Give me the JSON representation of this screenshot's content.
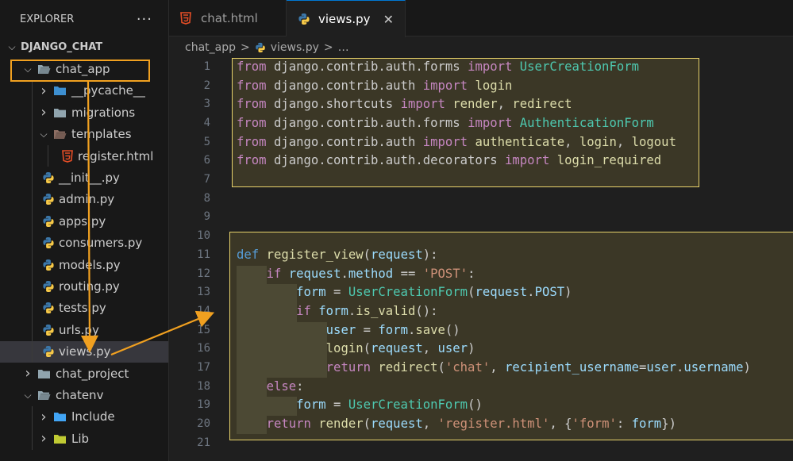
{
  "sidebar": {
    "header": "EXPLORER",
    "more": "···",
    "tree": [
      {
        "label": "DJANGO_CHAT",
        "type": "root",
        "expanded": true
      },
      {
        "label": "chat_app",
        "type": "folder",
        "expanded": true,
        "highlighted": true
      },
      {
        "label": "__pycache__",
        "type": "folder-special",
        "expanded": false
      },
      {
        "label": "migrations",
        "type": "folder",
        "expanded": false
      },
      {
        "label": "templates",
        "type": "folder",
        "expanded": true
      },
      {
        "label": "register.html",
        "type": "html"
      },
      {
        "label": "__init__.py",
        "type": "python"
      },
      {
        "label": "admin.py",
        "type": "python"
      },
      {
        "label": "apps.py",
        "type": "python"
      },
      {
        "label": "consumers.py",
        "type": "python"
      },
      {
        "label": "models.py",
        "type": "python"
      },
      {
        "label": "routing.py",
        "type": "python"
      },
      {
        "label": "tests.py",
        "type": "python"
      },
      {
        "label": "urls.py",
        "type": "python"
      },
      {
        "label": "views.py",
        "type": "python",
        "selected": true
      },
      {
        "label": "chat_project",
        "type": "folder",
        "expanded": false
      },
      {
        "label": "chatenv",
        "type": "folder",
        "expanded": true
      },
      {
        "label": "Include",
        "type": "folder-include",
        "expanded": false
      },
      {
        "label": "Lib",
        "type": "folder-lib",
        "expanded": false
      }
    ]
  },
  "tabs": [
    {
      "label": "chat.html",
      "icon": "html5-icon",
      "active": false
    },
    {
      "label": "views.py",
      "icon": "python-icon",
      "active": true,
      "close": "✕"
    }
  ],
  "breadcrumb": {
    "folder": "chat_app",
    "sep": ">",
    "file": "views.py",
    "tail": "…"
  },
  "code": {
    "line_numbers": [
      "1",
      "2",
      "3",
      "4",
      "5",
      "6",
      "7",
      "8",
      "9",
      "10",
      "11",
      "12",
      "13",
      "14",
      "15",
      "16",
      "17",
      "18",
      "19",
      "20",
      "21"
    ],
    "lines": [
      [
        [
          "kw",
          "from "
        ],
        [
          "pl",
          "django.contrib.auth.forms "
        ],
        [
          "kw",
          "import "
        ],
        [
          "cls",
          "UserCreationForm"
        ]
      ],
      [
        [
          "kw",
          "from "
        ],
        [
          "pl",
          "django.contrib.auth "
        ],
        [
          "kw",
          "import "
        ],
        [
          "fn",
          "login"
        ]
      ],
      [
        [
          "kw",
          "from "
        ],
        [
          "pl",
          "django.shortcuts "
        ],
        [
          "kw",
          "import "
        ],
        [
          "fn",
          "render"
        ],
        [
          "pl",
          ", "
        ],
        [
          "fn",
          "redirect"
        ]
      ],
      [
        [
          "kw",
          "from "
        ],
        [
          "pl",
          "django.contrib.auth.forms "
        ],
        [
          "kw",
          "import "
        ],
        [
          "cls",
          "AuthenticationForm"
        ]
      ],
      [
        [
          "kw",
          "from "
        ],
        [
          "pl",
          "django.contrib.auth "
        ],
        [
          "kw",
          "import "
        ],
        [
          "fn",
          "authenticate"
        ],
        [
          "pl",
          ", "
        ],
        [
          "fn",
          "login"
        ],
        [
          "pl",
          ", "
        ],
        [
          "fn",
          "logout"
        ]
      ],
      [
        [
          "kw",
          "from "
        ],
        [
          "pl",
          "django.contrib.auth.decorators "
        ],
        [
          "kw",
          "import "
        ],
        [
          "fn",
          "login_required"
        ]
      ],
      [],
      [],
      [],
      [],
      [
        [
          "def",
          "def "
        ],
        [
          "fn",
          "register_view"
        ],
        [
          "pl",
          "("
        ],
        [
          "var",
          "request"
        ],
        [
          "pl",
          "):"
        ]
      ],
      [
        [
          "pl",
          "    "
        ],
        [
          "kw",
          "if "
        ],
        [
          "var",
          "request"
        ],
        [
          "pl",
          "."
        ],
        [
          "var",
          "method"
        ],
        [
          "op",
          " == "
        ],
        [
          "str",
          "'POST'"
        ],
        [
          "pl",
          ":"
        ]
      ],
      [
        [
          "pl",
          "        "
        ],
        [
          "var",
          "form"
        ],
        [
          "op",
          " = "
        ],
        [
          "cls",
          "UserCreationForm"
        ],
        [
          "pl",
          "("
        ],
        [
          "var",
          "request"
        ],
        [
          "pl",
          "."
        ],
        [
          "var",
          "POST"
        ],
        [
          "pl",
          ")"
        ]
      ],
      [
        [
          "pl",
          "        "
        ],
        [
          "kw",
          "if "
        ],
        [
          "var",
          "form"
        ],
        [
          "pl",
          "."
        ],
        [
          "fn",
          "is_valid"
        ],
        [
          "pl",
          "():"
        ]
      ],
      [
        [
          "pl",
          "            "
        ],
        [
          "var",
          "user"
        ],
        [
          "op",
          " = "
        ],
        [
          "var",
          "form"
        ],
        [
          "pl",
          "."
        ],
        [
          "fn",
          "save"
        ],
        [
          "pl",
          "()"
        ]
      ],
      [
        [
          "pl",
          "            "
        ],
        [
          "fn",
          "login"
        ],
        [
          "pl",
          "("
        ],
        [
          "var",
          "request"
        ],
        [
          "pl",
          ", "
        ],
        [
          "var",
          "user"
        ],
        [
          "pl",
          ")"
        ]
      ],
      [
        [
          "pl",
          "            "
        ],
        [
          "kw",
          "return "
        ],
        [
          "fn",
          "redirect"
        ],
        [
          "pl",
          "("
        ],
        [
          "str",
          "'chat'"
        ],
        [
          "pl",
          ", "
        ],
        [
          "var",
          "recipient_username"
        ],
        [
          "op",
          "="
        ],
        [
          "var",
          "user"
        ],
        [
          "pl",
          "."
        ],
        [
          "var",
          "username"
        ],
        [
          "pl",
          ")"
        ]
      ],
      [
        [
          "pl",
          "    "
        ],
        [
          "kw",
          "else"
        ],
        [
          "pl",
          ":"
        ]
      ],
      [
        [
          "pl",
          "        "
        ],
        [
          "var",
          "form"
        ],
        [
          "op",
          " = "
        ],
        [
          "cls",
          "UserCreationForm"
        ],
        [
          "pl",
          "()"
        ]
      ],
      [
        [
          "pl",
          "    "
        ],
        [
          "kw",
          "return "
        ],
        [
          "fn",
          "render"
        ],
        [
          "pl",
          "("
        ],
        [
          "var",
          "request"
        ],
        [
          "pl",
          ", "
        ],
        [
          "str",
          "'register.html'"
        ],
        [
          "pl",
          ", {"
        ],
        [
          "str",
          "'form'"
        ],
        [
          "pl",
          ": "
        ],
        [
          "var",
          "form"
        ],
        [
          "pl",
          "})"
        ]
      ],
      []
    ]
  },
  "colors": {
    "annotation_border": "#e8d36b",
    "arrow": "#f0a020",
    "keyword": "#c586c0",
    "function": "#dcdcaa",
    "class": "#4ec9b0",
    "string": "#ce9178",
    "variable": "#9cdcfe"
  }
}
